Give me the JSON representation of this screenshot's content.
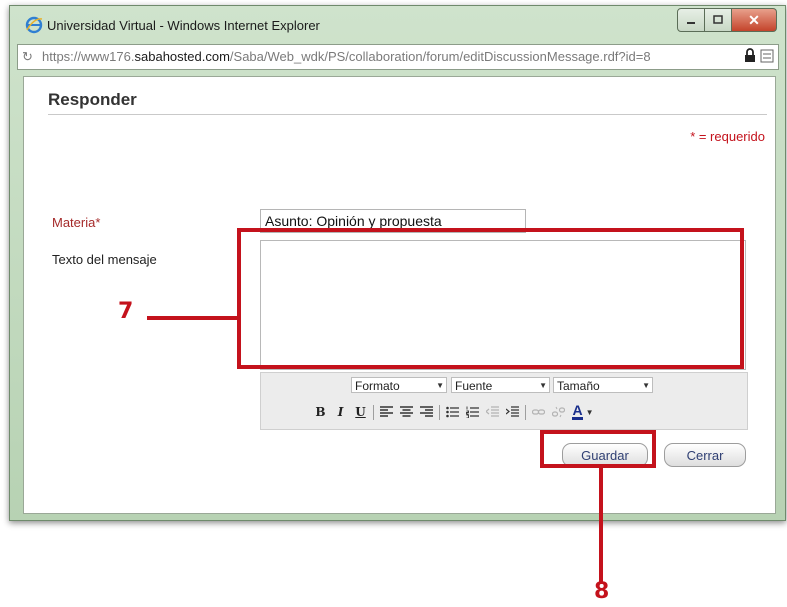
{
  "window": {
    "title": "Universidad Virtual - Windows Internet Explorer",
    "url_prefix": "https://www176.",
    "url_domain": "sabahosted.com",
    "url_path": "/Saba/Web_wdk/PS/collaboration/forum/editDiscussionMessage.rdf?id=8",
    "icons": {
      "app": "internet-explorer-icon",
      "lock": "lock-icon",
      "compat": "compatibility-view-icon"
    }
  },
  "page": {
    "heading": "Responder",
    "required_note": "* = requerido"
  },
  "form": {
    "subject_label": "Materia*",
    "subject_value": "Asunto: Opinión y propuesta",
    "message_label": "Texto del mensaje",
    "message_value": ""
  },
  "editor": {
    "format_label": "Formato",
    "font_label": "Fuente",
    "size_label": "Tamaño",
    "bold": "B",
    "italic": "I",
    "underline": "U",
    "font_color": "A"
  },
  "buttons": {
    "save": "Guardar",
    "close": "Cerrar"
  },
  "annotations": {
    "callout_message": "7",
    "callout_save": "8",
    "color": "#c4121c"
  }
}
